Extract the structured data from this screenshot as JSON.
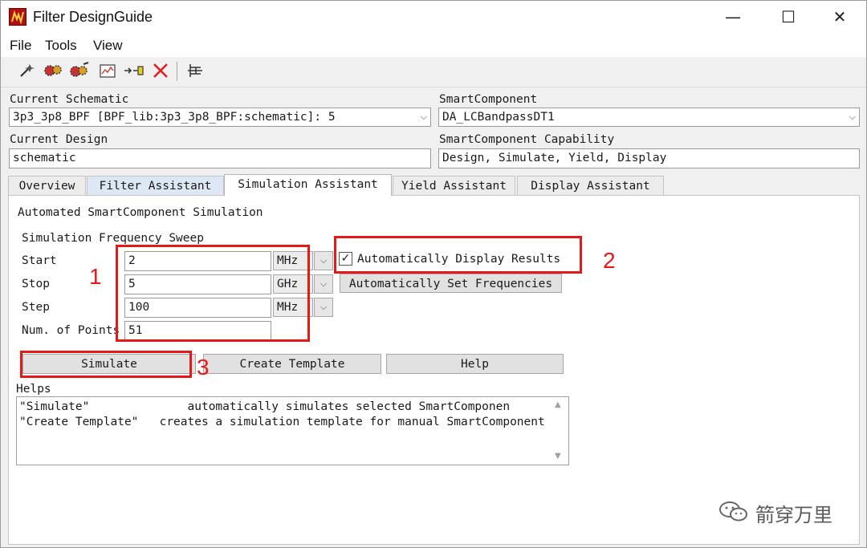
{
  "window": {
    "title": "Filter DesignGuide",
    "minimize": "—",
    "maximize": "☐",
    "close": "✕"
  },
  "menu": [
    "File",
    "Tools",
    "View"
  ],
  "toolbar": {
    "icons": [
      "wand-icon",
      "gears-icon",
      "gears-wand-icon",
      "plot-icon",
      "connector-icon",
      "delete-icon",
      "schematic-icon"
    ]
  },
  "schematic": {
    "label": "Current Schematic",
    "value": "3p3_3p8_BPF [BPF_lib:3p3_3p8_BPF:schematic]: 5"
  },
  "smart_component": {
    "label": "SmartComponent",
    "value": "DA_LCBandpassDT1"
  },
  "design": {
    "label": "Current Design",
    "value": "schematic"
  },
  "capability": {
    "label": "SmartComponent Capability",
    "value": "Design, Simulate, Yield, Display"
  },
  "tabs": [
    {
      "label": "Overview"
    },
    {
      "label": "Filter Assistant"
    },
    {
      "label": "Simulation Assistant"
    },
    {
      "label": "Yield Assistant"
    },
    {
      "label": "Display Assistant"
    }
  ],
  "panel": {
    "heading": "Automated SmartComponent Simulation",
    "sweep_label": "Simulation Frequency Sweep",
    "start": {
      "label": "Start",
      "value": "2",
      "unit": "MHz"
    },
    "stop": {
      "label": "Stop",
      "value": "5",
      "unit": "GHz"
    },
    "step": {
      "label": "Step",
      "value": "100",
      "unit": "MHz"
    },
    "points": {
      "label": "Num. of Points",
      "value": "51"
    },
    "auto_display": {
      "label": "Automatically Display Results",
      "checked": true,
      "check_glyph": "✓"
    },
    "auto_set_label": "Automatically Set Frequencies",
    "simulate_label": "Simulate",
    "template_label": "Create Template",
    "help_label": "Help",
    "helps_label": "Helps",
    "helps_lines": [
      "\"Simulate\"              automatically simulates selected SmartComponen",
      "\"Create Template\"   creates a simulation template for manual SmartComponent"
    ]
  },
  "annotations": [
    "1",
    "2",
    "3"
  ],
  "watermark": "箭穿万里",
  "colors": {
    "annotation": "#e61919",
    "tab_active_bg": "#ffffff",
    "tab_blue_bg": "#dde8f4"
  }
}
